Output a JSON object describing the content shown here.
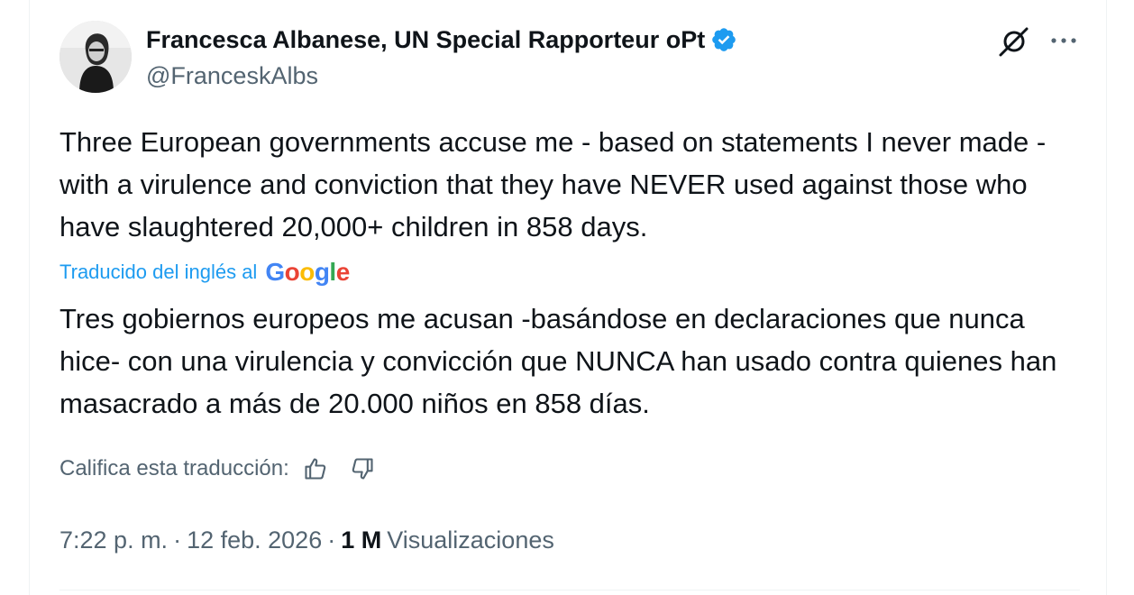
{
  "author": {
    "display_name": "Francesca Albanese, UN Special Rapporteur oPt",
    "handle": "@FranceskAlbs",
    "verified_color": "#1d9bf0"
  },
  "header_actions": {
    "grok_icon": "grok-icon",
    "more_icon": "more-icon"
  },
  "tweet": {
    "text": "Three European governments accuse me - based on statements I never made -with a virulence and conviction that they have NEVER used against those who have slaughtered 20,000+ children in 858 days.",
    "translated_label": "Traducido del inglés al",
    "translation_provider": "Google",
    "translation": "Tres gobiernos europeos me acusan -basándose en declaraciones que nunca hice- con una virulencia y convicción que NUNCA han usado contra quienes han masacrado a más de 20.000 niños en 858 días.",
    "rate_label": "Califica esta traducción:"
  },
  "meta": {
    "time": "7:22 p. m.",
    "separator": "·",
    "date": "12 feb. 2026",
    "views_count": "1 M",
    "views_label": "Visualizaciones"
  },
  "colors": {
    "accent": "#1d9bf0",
    "text_primary": "#0f1419",
    "text_secondary": "#536471",
    "google_blue": "#4285f4",
    "google_red": "#ea4335",
    "google_yellow": "#fbbc05",
    "google_green": "#34a853"
  }
}
